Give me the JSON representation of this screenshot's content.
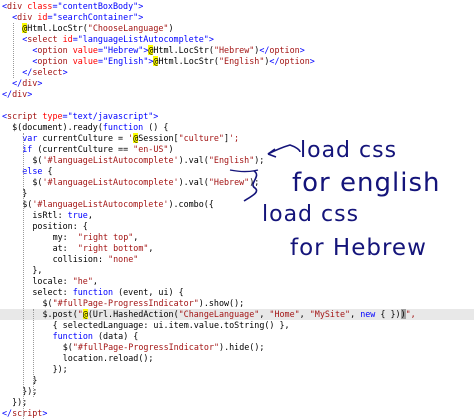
{
  "code_lines": [
    {
      "indent": 0,
      "tokens": [
        {
          "t": "<",
          "c": "#0000ff"
        },
        {
          "t": "div",
          "c": "#a31515"
        },
        {
          "t": " ",
          "c": "#000000"
        },
        {
          "t": "class",
          "c": "#ff0000"
        },
        {
          "t": "=",
          "c": "#0000ff"
        },
        {
          "t": "\"contentBoxBody\"",
          "c": "#0000ff"
        },
        {
          "t": ">",
          "c": "#0000ff"
        }
      ]
    },
    {
      "indent": 2,
      "tokens": [
        {
          "t": "<",
          "c": "#0000ff"
        },
        {
          "t": "div",
          "c": "#a31515"
        },
        {
          "t": " ",
          "c": "#000000"
        },
        {
          "t": "id",
          "c": "#ff0000"
        },
        {
          "t": "=",
          "c": "#0000ff"
        },
        {
          "t": "\"searchContainer\"",
          "c": "#0000ff"
        },
        {
          "t": ">",
          "c": "#0000ff"
        }
      ]
    },
    {
      "indent": 4,
      "tokens": [
        {
          "t": "@",
          "c": "#000000",
          "bg": "#ffff00"
        },
        {
          "t": "Html.LocStr(",
          "c": "#000000"
        },
        {
          "t": "\"ChooseLanguage\"",
          "c": "#a31515"
        },
        {
          "t": ")",
          "c": "#000000"
        }
      ]
    },
    {
      "indent": 4,
      "tokens": [
        {
          "t": "<",
          "c": "#0000ff"
        },
        {
          "t": "select",
          "c": "#a31515"
        },
        {
          "t": " ",
          "c": "#000000"
        },
        {
          "t": "id",
          "c": "#ff0000"
        },
        {
          "t": "=",
          "c": "#0000ff"
        },
        {
          "t": "\"languageListAutocomplete\"",
          "c": "#0000ff"
        },
        {
          "t": ">",
          "c": "#0000ff"
        }
      ]
    },
    {
      "indent": 6,
      "tokens": [
        {
          "t": "<",
          "c": "#0000ff"
        },
        {
          "t": "option",
          "c": "#a31515"
        },
        {
          "t": " ",
          "c": "#000000"
        },
        {
          "t": "value",
          "c": "#ff0000"
        },
        {
          "t": "=",
          "c": "#0000ff"
        },
        {
          "t": "\"Hebrew\"",
          "c": "#0000ff"
        },
        {
          "t": ">",
          "c": "#0000ff"
        },
        {
          "t": "@",
          "c": "#000000",
          "bg": "#ffff00"
        },
        {
          "t": "Html.LocStr(",
          "c": "#000000"
        },
        {
          "t": "\"Hebrew\"",
          "c": "#a31515"
        },
        {
          "t": ")",
          "c": "#000000"
        },
        {
          "t": "</",
          "c": "#0000ff"
        },
        {
          "t": "option",
          "c": "#a31515"
        },
        {
          "t": ">",
          "c": "#0000ff"
        }
      ]
    },
    {
      "indent": 6,
      "tokens": [
        {
          "t": "<",
          "c": "#0000ff"
        },
        {
          "t": "option",
          "c": "#a31515"
        },
        {
          "t": " ",
          "c": "#000000"
        },
        {
          "t": "value",
          "c": "#ff0000"
        },
        {
          "t": "=",
          "c": "#0000ff"
        },
        {
          "t": "\"English\"",
          "c": "#0000ff"
        },
        {
          "t": ">",
          "c": "#0000ff"
        },
        {
          "t": "@",
          "c": "#000000",
          "bg": "#ffff00"
        },
        {
          "t": "Html.LocStr(",
          "c": "#000000"
        },
        {
          "t": "\"English\"",
          "c": "#a31515"
        },
        {
          "t": ")",
          "c": "#000000"
        },
        {
          "t": "</",
          "c": "#0000ff"
        },
        {
          "t": "option",
          "c": "#a31515"
        },
        {
          "t": ">",
          "c": "#0000ff"
        }
      ]
    },
    {
      "indent": 4,
      "tokens": [
        {
          "t": "</",
          "c": "#0000ff"
        },
        {
          "t": "select",
          "c": "#a31515"
        },
        {
          "t": ">",
          "c": "#0000ff"
        }
      ]
    },
    {
      "indent": 2,
      "tokens": [
        {
          "t": "</",
          "c": "#0000ff"
        },
        {
          "t": "div",
          "c": "#a31515"
        },
        {
          "t": ">",
          "c": "#0000ff"
        }
      ]
    },
    {
      "indent": 0,
      "tokens": [
        {
          "t": "</",
          "c": "#0000ff"
        },
        {
          "t": "div",
          "c": "#a31515"
        },
        {
          "t": ">",
          "c": "#0000ff"
        }
      ]
    },
    {
      "indent": 0,
      "tokens": []
    },
    {
      "indent": 0,
      "tokens": [
        {
          "t": "<",
          "c": "#0000ff"
        },
        {
          "t": "script",
          "c": "#a31515"
        },
        {
          "t": " ",
          "c": "#000000"
        },
        {
          "t": "type",
          "c": "#ff0000"
        },
        {
          "t": "=",
          "c": "#0000ff"
        },
        {
          "t": "\"text/javascript\"",
          "c": "#0000ff"
        },
        {
          "t": ">",
          "c": "#0000ff"
        }
      ]
    },
    {
      "indent": 2,
      "tokens": [
        {
          "t": "$(document).ready(",
          "c": "#000000"
        },
        {
          "t": "function",
          "c": "#0000ff"
        },
        {
          "t": " () {",
          "c": "#000000"
        }
      ]
    },
    {
      "indent": 4,
      "tokens": [
        {
          "t": "var",
          "c": "#0000ff"
        },
        {
          "t": " currentCulture = ",
          "c": "#000000"
        },
        {
          "t": "'",
          "c": "#a31515"
        },
        {
          "t": "@",
          "c": "#000000",
          "bg": "#ffff00"
        },
        {
          "t": "Session[",
          "c": "#000000"
        },
        {
          "t": "\"culture\"",
          "c": "#a31515"
        },
        {
          "t": "]",
          "c": "#000000"
        },
        {
          "t": "';",
          "c": "#a31515"
        }
      ]
    },
    {
      "indent": 4,
      "tokens": [
        {
          "t": "if",
          "c": "#0000ff"
        },
        {
          "t": " (currentCulture == ",
          "c": "#000000"
        },
        {
          "t": "\"en-US\"",
          "c": "#a31515"
        },
        {
          "t": ")",
          "c": "#000000"
        }
      ]
    },
    {
      "indent": 6,
      "tokens": [
        {
          "t": "$(",
          "c": "#000000"
        },
        {
          "t": "'#languageListAutocomplete'",
          "c": "#a31515"
        },
        {
          "t": ").val(",
          "c": "#000000"
        },
        {
          "t": "\"English\"",
          "c": "#a31515"
        },
        {
          "t": ");",
          "c": "#000000"
        }
      ]
    },
    {
      "indent": 4,
      "tokens": [
        {
          "t": "else",
          "c": "#0000ff"
        },
        {
          "t": " {",
          "c": "#000000"
        }
      ]
    },
    {
      "indent": 6,
      "tokens": [
        {
          "t": "$(",
          "c": "#000000"
        },
        {
          "t": "'#languageListAutocomplete'",
          "c": "#a31515"
        },
        {
          "t": ").val(",
          "c": "#000000"
        },
        {
          "t": "\"Hebrew\"",
          "c": "#a31515"
        },
        {
          "t": ");",
          "c": "#000000"
        }
      ]
    },
    {
      "indent": 4,
      "tokens": [
        {
          "t": "}",
          "c": "#000000"
        }
      ]
    },
    {
      "indent": 4,
      "tokens": [
        {
          "t": "$(",
          "c": "#000000"
        },
        {
          "t": "'#languageListAutocomplete'",
          "c": "#a31515"
        },
        {
          "t": ").combo({",
          "c": "#000000"
        }
      ]
    },
    {
      "indent": 6,
      "tokens": [
        {
          "t": "isRtl: ",
          "c": "#000000"
        },
        {
          "t": "true",
          "c": "#0000ff"
        },
        {
          "t": ",",
          "c": "#000000"
        }
      ]
    },
    {
      "indent": 6,
      "tokens": [
        {
          "t": "position: {",
          "c": "#000000"
        }
      ]
    },
    {
      "indent": 10,
      "tokens": [
        {
          "t": "my:  ",
          "c": "#000000"
        },
        {
          "t": "\"right top\"",
          "c": "#a31515"
        },
        {
          "t": ",",
          "c": "#000000"
        }
      ]
    },
    {
      "indent": 10,
      "tokens": [
        {
          "t": "at:  ",
          "c": "#000000"
        },
        {
          "t": "\"right bottom\"",
          "c": "#a31515"
        },
        {
          "t": ",",
          "c": "#000000"
        }
      ]
    },
    {
      "indent": 10,
      "tokens": [
        {
          "t": "collision: ",
          "c": "#000000"
        },
        {
          "t": "\"none\"",
          "c": "#a31515"
        }
      ]
    },
    {
      "indent": 6,
      "tokens": [
        {
          "t": "},",
          "c": "#000000"
        }
      ]
    },
    {
      "indent": 6,
      "tokens": [
        {
          "t": "locale: ",
          "c": "#000000"
        },
        {
          "t": "\"he\"",
          "c": "#a31515"
        },
        {
          "t": ",",
          "c": "#000000"
        }
      ]
    },
    {
      "indent": 6,
      "tokens": [
        {
          "t": "select: ",
          "c": "#000000"
        },
        {
          "t": "function",
          "c": "#0000ff"
        },
        {
          "t": " (event, ui) {",
          "c": "#000000"
        }
      ]
    },
    {
      "indent": 8,
      "tokens": [
        {
          "t": "$(",
          "c": "#000000"
        },
        {
          "t": "\"#fullPage-ProgressIndicator\"",
          "c": "#a31515"
        },
        {
          "t": ").show();",
          "c": "#000000"
        }
      ]
    },
    {
      "indent": 8,
      "highlight": true,
      "tokens": [
        {
          "t": "$.post(",
          "c": "#000000"
        },
        {
          "t": "\"",
          "c": "#a31515"
        },
        {
          "t": "@",
          "c": "#000000",
          "bg": "#ffff00"
        },
        {
          "t": "(Url.HashedAction(",
          "c": "#000000"
        },
        {
          "t": "\"ChangeLanguage\"",
          "c": "#a31515"
        },
        {
          "t": ", ",
          "c": "#000000"
        },
        {
          "t": "\"Home\"",
          "c": "#a31515"
        },
        {
          "t": ", ",
          "c": "#000000"
        },
        {
          "t": "\"MySite\"",
          "c": "#a31515"
        },
        {
          "t": ", ",
          "c": "#000000"
        },
        {
          "t": "new",
          "c": "#0000ff"
        },
        {
          "t": " { })",
          "c": "#000000"
        },
        {
          "t": ")",
          "c": "#000000",
          "bg": "#a0a0a0"
        },
        {
          "t": "\",",
          "c": "#a31515"
        }
      ]
    },
    {
      "indent": 10,
      "tokens": [
        {
          "t": "{ selectedLanguage: ui.item.value.toString() },",
          "c": "#000000"
        }
      ]
    },
    {
      "indent": 10,
      "tokens": [
        {
          "t": "function",
          "c": "#0000ff"
        },
        {
          "t": " (data) {",
          "c": "#000000"
        }
      ]
    },
    {
      "indent": 12,
      "tokens": [
        {
          "t": "$(",
          "c": "#000000"
        },
        {
          "t": "\"#fullPage-ProgressIndicator\"",
          "c": "#a31515"
        },
        {
          "t": ").hide();",
          "c": "#000000"
        }
      ]
    },
    {
      "indent": 12,
      "tokens": [
        {
          "t": "location.reload();",
          "c": "#000000"
        }
      ]
    },
    {
      "indent": 10,
      "tokens": [
        {
          "t": "});",
          "c": "#000000"
        }
      ]
    },
    {
      "indent": 6,
      "tokens": [
        {
          "t": "}",
          "c": "#000000"
        }
      ]
    },
    {
      "indent": 4,
      "tokens": [
        {
          "t": "});",
          "c": "#000000"
        }
      ]
    },
    {
      "indent": 2,
      "tokens": [
        {
          "t": "});",
          "c": "#000000"
        }
      ]
    },
    {
      "indent": 0,
      "tokens": [
        {
          "t": "</",
          "c": "#0000ff"
        },
        {
          "t": "script",
          "c": "#a31515"
        },
        {
          "t": ">",
          "c": "#0000ff"
        }
      ]
    }
  ],
  "annotations": {
    "english": {
      "line1": "load css",
      "line2": "for english"
    },
    "hebrew": {
      "line1": "load css",
      "line2": "for Hebrew"
    }
  },
  "colors": {
    "background": "#ffffff",
    "keyword": "#0000ff",
    "element": "#a31515",
    "attribute": "#ff0000",
    "razor_marker": "#ffff00",
    "current_line": "#e8e8e8",
    "ink": "#14147a"
  }
}
